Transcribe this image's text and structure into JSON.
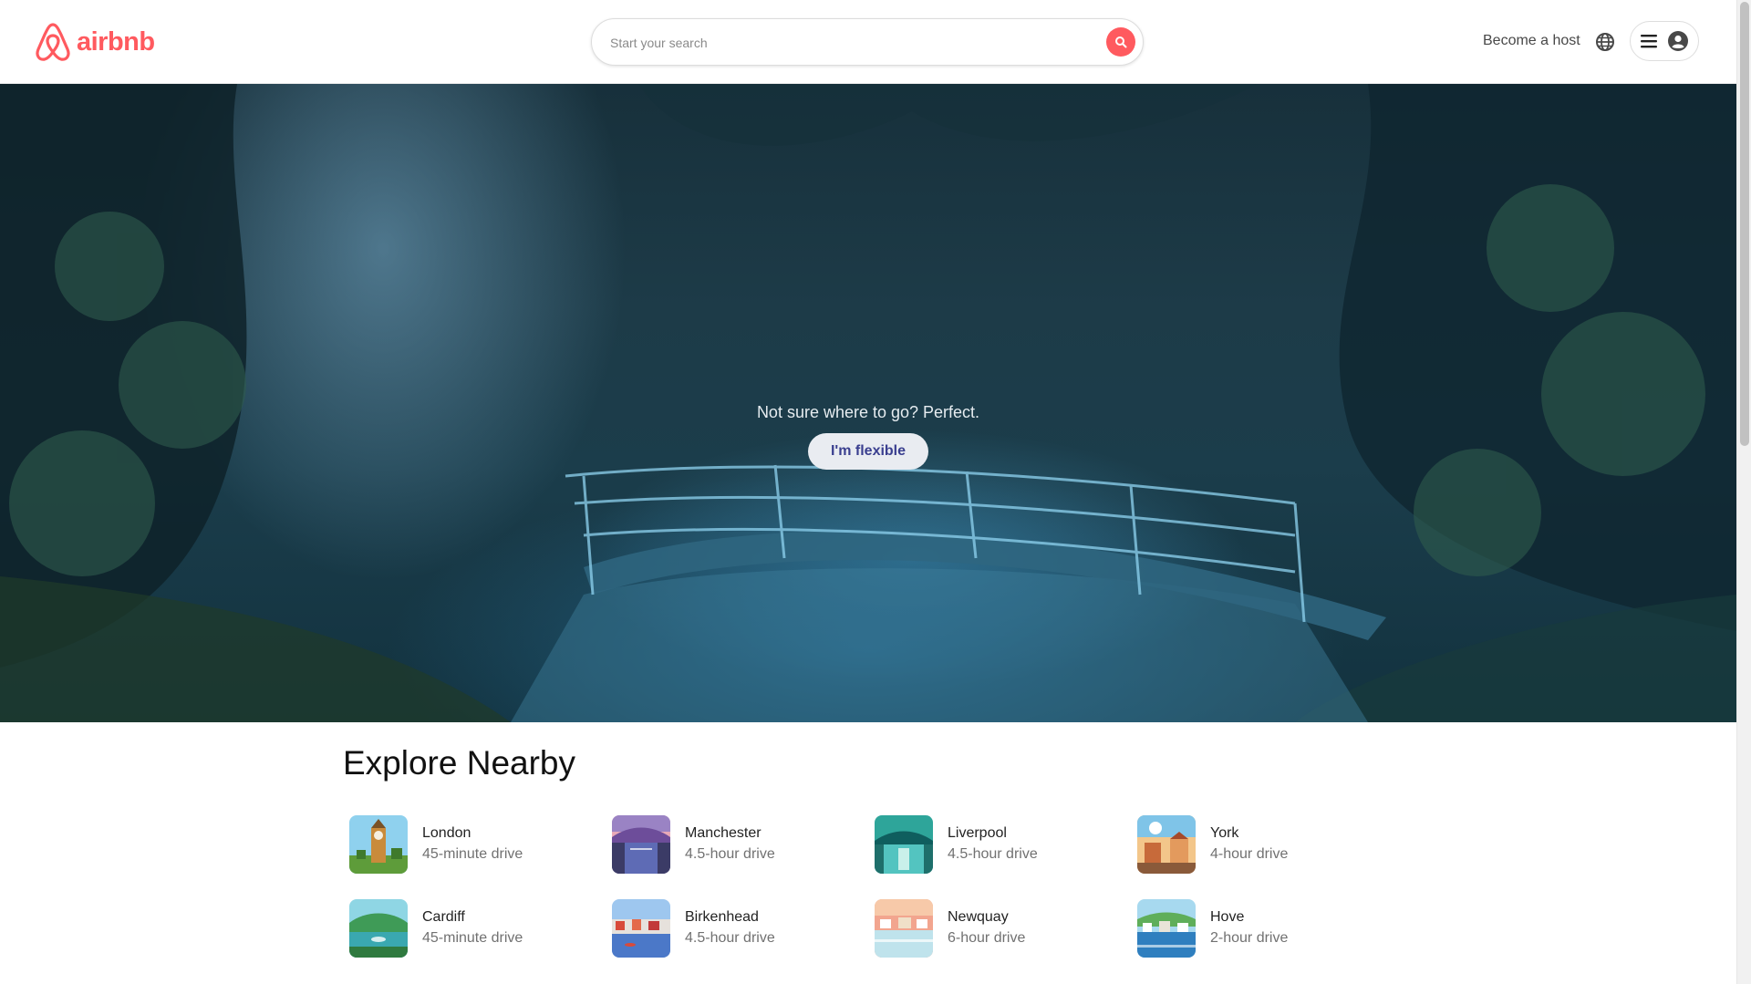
{
  "header": {
    "logo_text": "airbnb",
    "brand_color": "#ff5a5f",
    "search_placeholder": "Start your search",
    "become_host": "Become a host",
    "icons": [
      "airbnb-logo-icon",
      "search-icon",
      "globe-icon",
      "menu-icon",
      "user-icon"
    ]
  },
  "hero": {
    "tagline": "Not sure where to go? Perfect.",
    "button_label": "I'm flexible"
  },
  "explore": {
    "title": "Explore Nearby",
    "items": [
      {
        "city": "London",
        "drive": "45-minute drive"
      },
      {
        "city": "Manchester",
        "drive": "4.5-hour drive"
      },
      {
        "city": "Liverpool",
        "drive": "4.5-hour drive"
      },
      {
        "city": "York",
        "drive": "4-hour drive"
      },
      {
        "city": "Cardiff",
        "drive": "45-minute drive"
      },
      {
        "city": "Birkenhead",
        "drive": "4.5-hour drive"
      },
      {
        "city": "Newquay",
        "drive": "6-hour drive"
      },
      {
        "city": "Hove",
        "drive": "2-hour drive"
      }
    ]
  }
}
